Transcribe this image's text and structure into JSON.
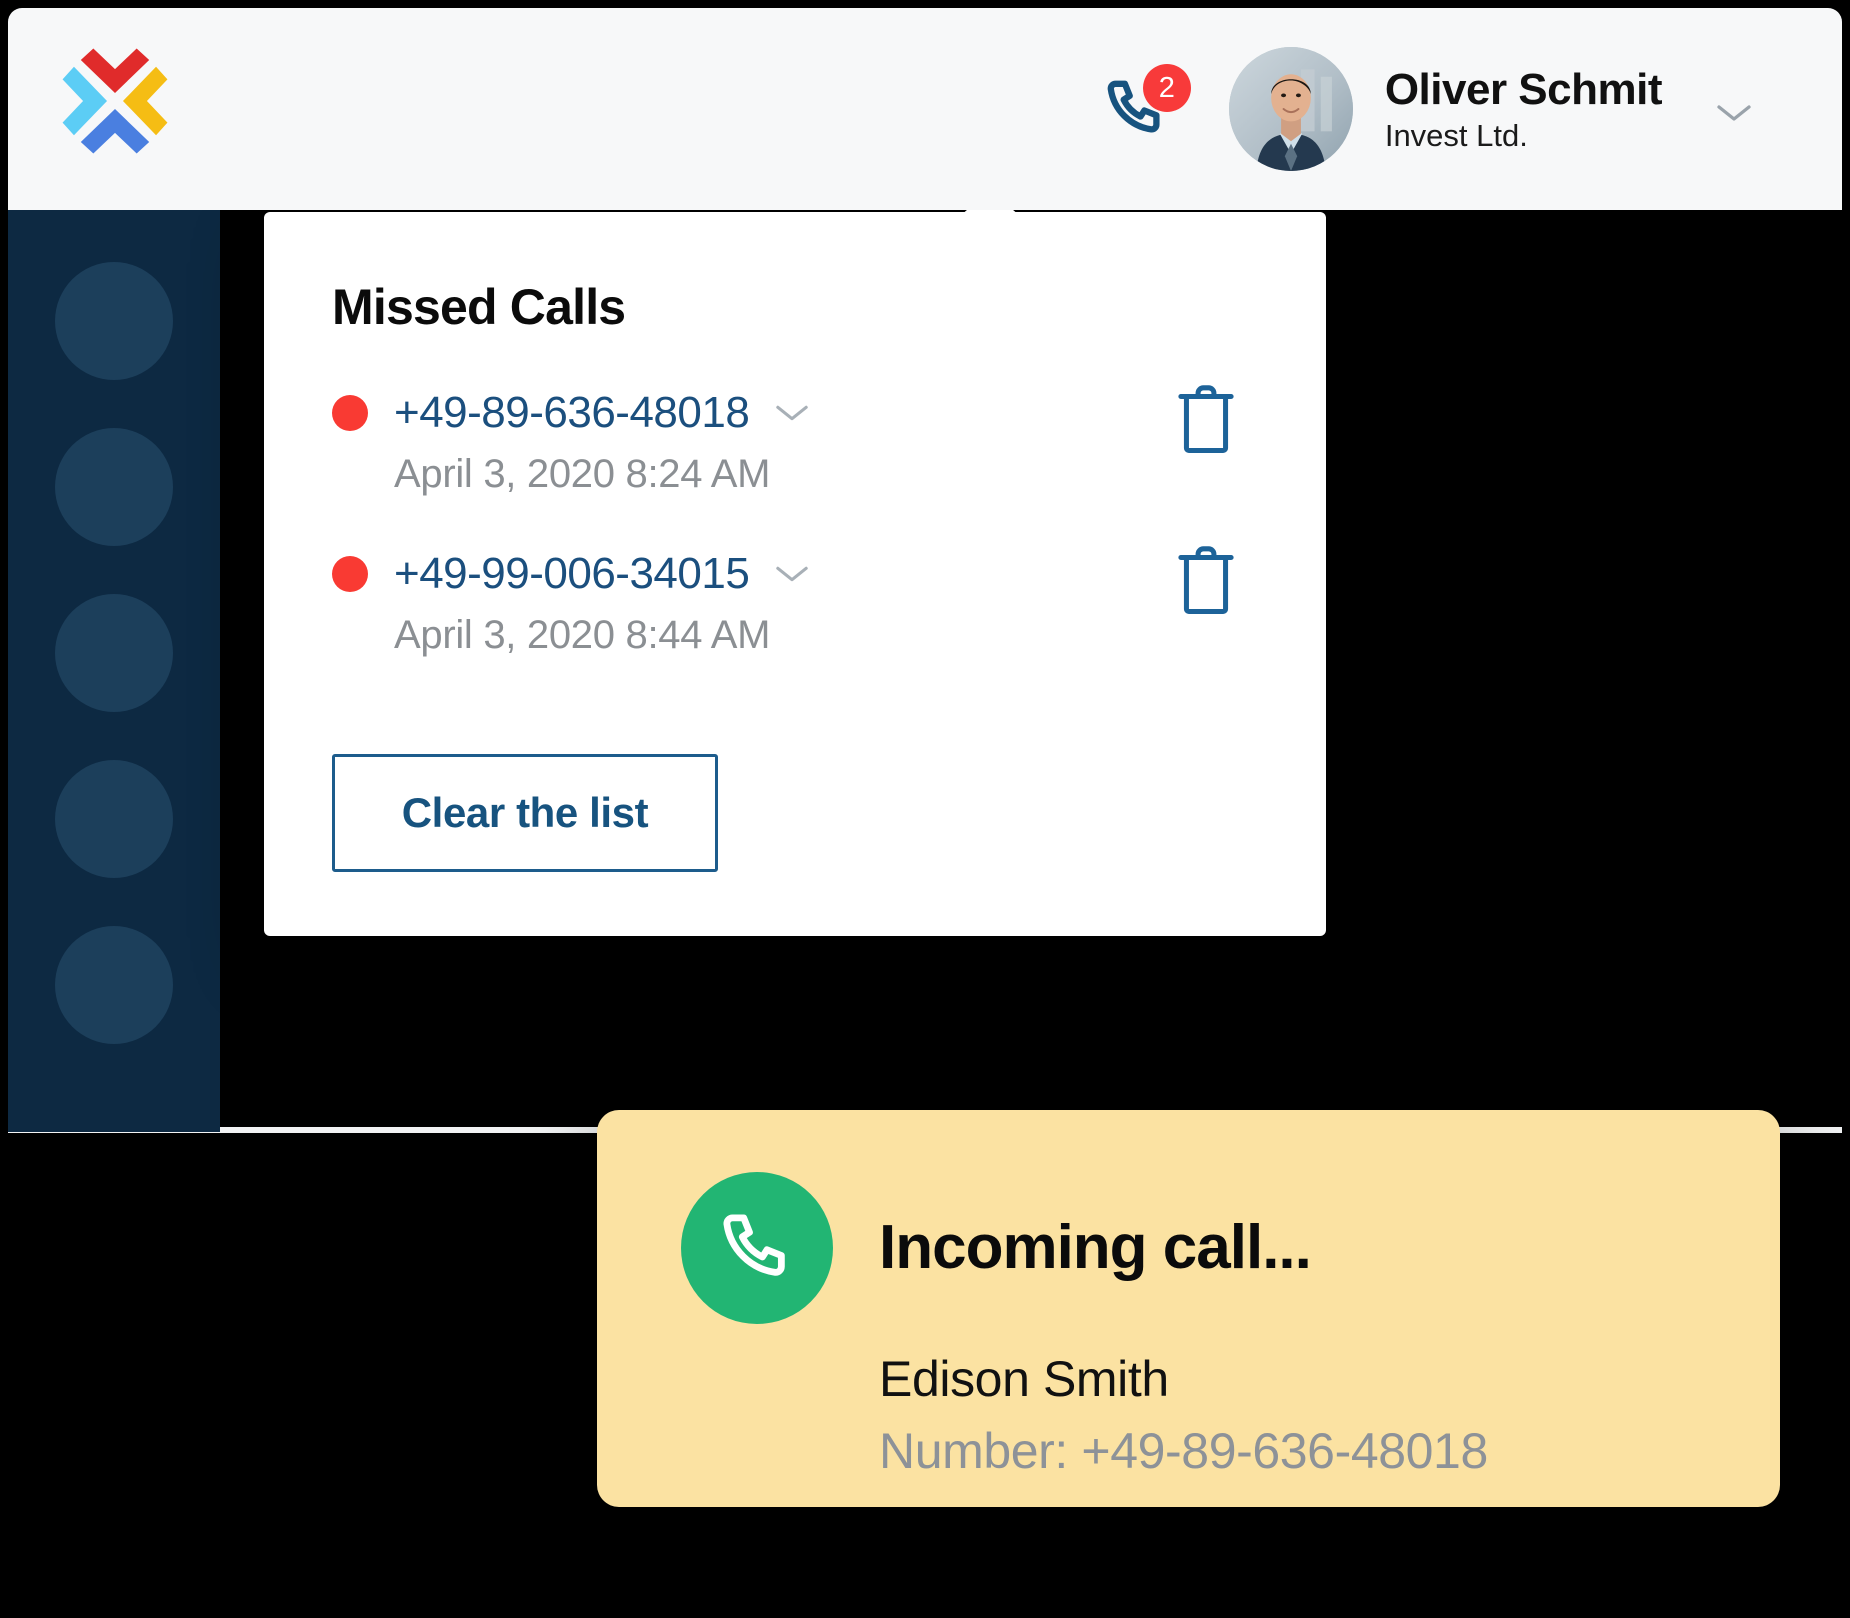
{
  "appbar": {
    "logo_name": "brand-x-logo",
    "logo_colors": [
      "#e02b2b",
      "#f5bd14",
      "#4a7fe0",
      "#5ccdf5"
    ],
    "phone_icon": "phone-icon",
    "missed_badge_count": "2",
    "badge_color": "#f83a3a",
    "user": {
      "avatar_alt": "user-avatar",
      "name": "Oliver Schmit",
      "organization": "Invest Ltd.",
      "caret_icon": "chevron-down-icon"
    }
  },
  "sidebar": {
    "background": "#0d2942",
    "item_count": 5,
    "items": [
      {
        "name": "sidebar-item-1"
      },
      {
        "name": "sidebar-item-2"
      },
      {
        "name": "sidebar-item-3"
      },
      {
        "name": "sidebar-item-4"
      },
      {
        "name": "sidebar-item-5"
      }
    ]
  },
  "missed_calls": {
    "title": "Missed Calls",
    "status_dot_color": "#f93a33",
    "number_color": "#1b4f7e",
    "delete_icon": "trash-icon",
    "row_caret_icon": "chevron-down-icon",
    "calls": [
      {
        "number": "+49-89-636-48018",
        "time": "April 3, 2020 8:24 AM"
      },
      {
        "number": "+49-99-006-34015",
        "time": "April 3, 2020 8:44 AM"
      }
    ],
    "clear_button_label": "Clear the list"
  },
  "incoming_call_toast": {
    "background": "#fbe2a2",
    "icon": "phone-icon",
    "icon_background": "#22b573",
    "title": "Incoming call...",
    "caller_name": "Edison Smith",
    "number_line": "Number: +49-89-636-48018"
  }
}
